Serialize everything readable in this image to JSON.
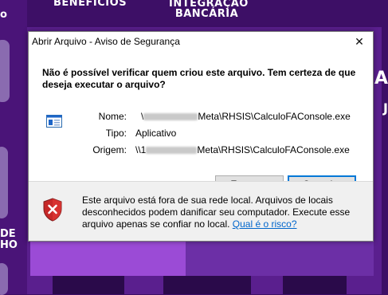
{
  "background": {
    "nav_left": "BENEFÍCIOS",
    "nav_right_line1": "INTEGRAÇÃO",
    "nav_right_line2": "BANCÁRIA",
    "side_top": "o",
    "side_mid_line1": "DE",
    "side_mid_line2": "HO"
  },
  "dialog": {
    "title": "Abrir Arquivo - Aviso de Segurança",
    "heading": "Não é possível verificar quem criou este arquivo. Tem certeza de que deseja executar o arquivo?",
    "fields": {
      "name_label": "Nome:",
      "name_prefix": "\\",
      "name_suffix": "Meta\\RHSIS\\CalculoFAConsole.exe",
      "type_label": "Tipo:",
      "type_value": "Aplicativo",
      "origin_label": "Origem:",
      "origin_prefix": "\\\\1",
      "origin_suffix": "Meta\\RHSIS\\CalculoFAConsole.exe"
    },
    "buttons": {
      "execute": "Executar",
      "cancel": "Cancelar"
    },
    "footer": {
      "text": "Este arquivo está fora de sua rede local. Arquivos de locais desconhecidos podem danificar seu computador. Execute esse arquivo apenas se confiar no local.",
      "link": "Qual é o risco?"
    },
    "close_glyph": "✕"
  }
}
